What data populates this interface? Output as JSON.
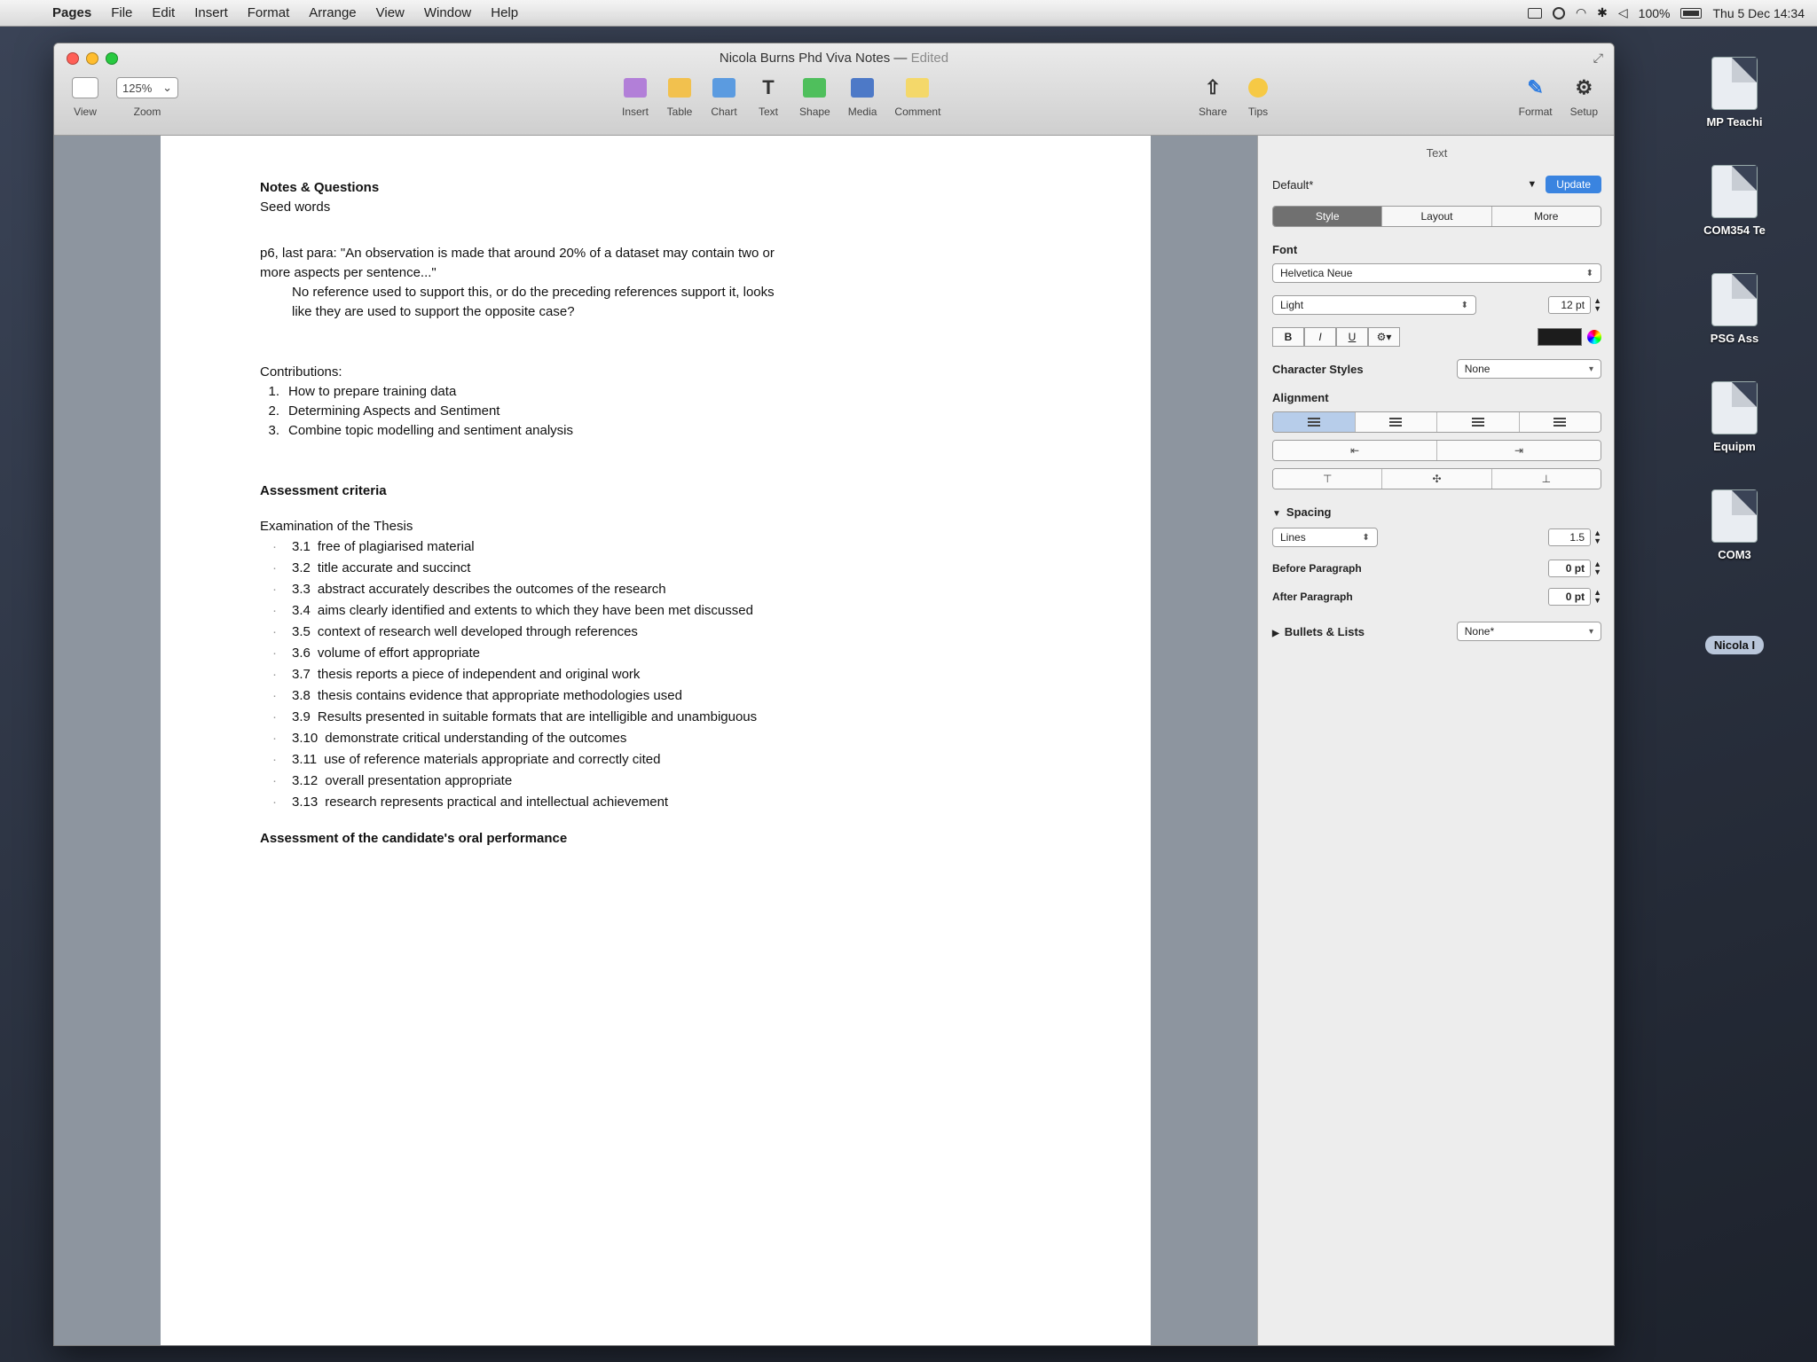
{
  "menubar": {
    "app": "Pages",
    "items": [
      "File",
      "Edit",
      "Insert",
      "Format",
      "Arrange",
      "View",
      "Window",
      "Help"
    ],
    "battery": "100%",
    "clock": "Thu 5 Dec 14:34"
  },
  "desktop": {
    "icons": [
      "MP Teachi",
      "COM354 Te",
      "PSG Ass",
      "Equipm",
      "COM3"
    ],
    "user_tag": "Nicola I"
  },
  "window": {
    "title": "Nicola Burns Phd Viva Notes",
    "status": "Edited",
    "zoom": "125%",
    "left_buttons": [
      "View",
      "Zoom"
    ],
    "insert_buttons": [
      "Insert",
      "Table",
      "Chart",
      "Text",
      "Shape",
      "Media",
      "Comment"
    ],
    "share_buttons": [
      "Share",
      "Tips"
    ],
    "right_buttons": [
      "Format",
      "Setup"
    ]
  },
  "document": {
    "notes_heading": "Notes & Questions",
    "seed_words": "Seed words",
    "quote_line1": "p6, last para: \"An observation is made that around 20% of a dataset may contain two or",
    "quote_line2": "more aspects per sentence...\"",
    "question_line1": "No reference used to support this, or do the preceding references support it, looks",
    "question_line2": "like they are used to support the opposite case?",
    "contributions_heading": "Contributions:",
    "contributions": [
      {
        "num": "1.",
        "text": "How to prepare training data"
      },
      {
        "num": "2.",
        "text": "Determining Aspects and Sentiment"
      },
      {
        "num": "3.",
        "text": "Combine topic modelling and sentiment analysis"
      }
    ],
    "assessment_heading": "Assessment criteria",
    "examination_heading": "Examination of the Thesis",
    "criteria": [
      {
        "num": "3.1",
        "text": "free of plagiarised material"
      },
      {
        "num": "3.2",
        "text": "title accurate and succinct"
      },
      {
        "num": "3.3",
        "text": "abstract accurately describes the outcomes of the research"
      },
      {
        "num": "3.4",
        "text": "aims clearly identified and extents to which they have been met discussed"
      },
      {
        "num": "3.5",
        "text": "context of research well developed through references"
      },
      {
        "num": "3.6",
        "text": "volume of effort appropriate"
      },
      {
        "num": "3.7",
        "text": "thesis reports a piece of independent and original work"
      },
      {
        "num": "3.8",
        "text": "thesis contains evidence that appropriate methodologies used"
      },
      {
        "num": "3.9",
        "text": "Results presented in suitable formats that are intelligible and unambiguous"
      },
      {
        "num": "3.10",
        "text": "demonstrate critical understanding of the outcomes"
      },
      {
        "num": "3.11",
        "text": "use of reference materials appropriate and  correctly cited"
      },
      {
        "num": "3.12",
        "text": "overall presentation appropriate"
      },
      {
        "num": "3.13",
        "text": "research represents practical and intellectual achievement"
      }
    ],
    "oral_heading": "Assessment of the candidate's oral performance"
  },
  "inspector": {
    "title": "Text",
    "paragraph_style": "Default*",
    "update_label": "Update",
    "tabs": [
      "Style",
      "Layout",
      "More"
    ],
    "active_tab": "Style",
    "font_label": "Font",
    "font_family": "Helvetica Neue",
    "font_weight": "Light",
    "font_size": "12 pt",
    "bold": "B",
    "italic": "I",
    "underline": "U",
    "text_color": "#1c1c1c",
    "character_styles_label": "Character Styles",
    "character_style": "None",
    "alignment_label": "Alignment",
    "spacing_label": "Spacing",
    "spacing_mode": "Lines",
    "spacing_value": "1.5",
    "before_paragraph_label": "Before Paragraph",
    "before_paragraph": "0 pt",
    "after_paragraph_label": "After Paragraph",
    "after_paragraph": "0 pt",
    "bullets_label": "Bullets & Lists",
    "bullets_value": "None*"
  }
}
